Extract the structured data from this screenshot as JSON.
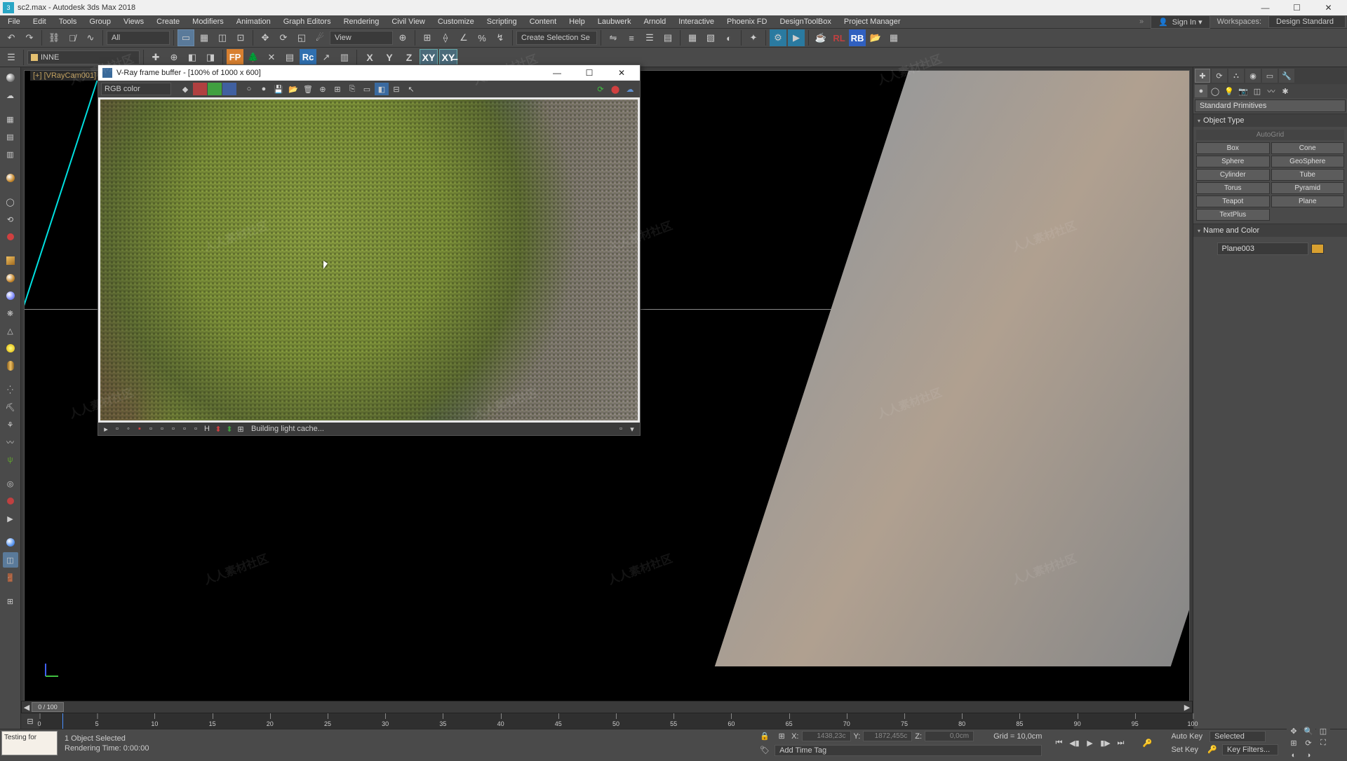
{
  "app": {
    "filename": "sc2.max",
    "title": "Autodesk 3ds Max 2018",
    "fullTitle": "sc2.max - Autodesk 3ds Max 2018"
  },
  "menus": [
    "File",
    "Edit",
    "Tools",
    "Group",
    "Views",
    "Create",
    "Modifiers",
    "Animation",
    "Graph Editors",
    "Rendering",
    "Civil View",
    "Customize",
    "Scripting",
    "Content",
    "Help",
    "Laubwerk",
    "Arnold",
    "Interactive",
    "Phoenix FD",
    "DesignToolBox",
    "Project Manager"
  ],
  "signin": "Sign In",
  "workspaces_label": "Workspaces:",
  "workspace": "Design Standard",
  "toolbar": {
    "allFilter": "All",
    "viewDrop": "View",
    "createSel": "Create Selection Se"
  },
  "layer": {
    "name": "INNE"
  },
  "viewport": {
    "label": "[+] [VRayCam001]"
  },
  "vfb": {
    "title": "V-Ray frame buffer - [100% of 1000 x 600]",
    "channel": "RGB color",
    "status": "Building light cache..."
  },
  "panel": {
    "category": "Standard Primitives",
    "rollout1": "Object Type",
    "autogrid": "AutoGrid",
    "buttons": [
      "Box",
      "Cone",
      "Sphere",
      "GeoSphere",
      "Cylinder",
      "Tube",
      "Torus",
      "Pyramid",
      "Teapot",
      "Plane",
      "TextPlus",
      ""
    ],
    "rollout2": "Name and Color",
    "objname": "Plane003"
  },
  "timeslider": {
    "frame": "0 / 100",
    "ticks": [
      0,
      5,
      10,
      15,
      20,
      25,
      30,
      35,
      40,
      45,
      50,
      55,
      60,
      65,
      70,
      75,
      80,
      85,
      90,
      95,
      100
    ]
  },
  "status": {
    "script": "Testing for",
    "selected": "1 Object Selected",
    "renderTime": "Rendering Time: 0:00:00",
    "x": "1438,23c",
    "xlabel": "X:",
    "y": "1872,455c",
    "ylabel": "Y:",
    "z": "0,0cm",
    "zlabel": "Z:",
    "grid": "Grid = 10,0cm",
    "addTimeTag": "Add Time Tag",
    "autoKey": "Auto Key",
    "setKey": "Set Key",
    "keyMode": "Selected",
    "keyFilters": "Key Filters..."
  },
  "watermark_text": "人人素材社区"
}
